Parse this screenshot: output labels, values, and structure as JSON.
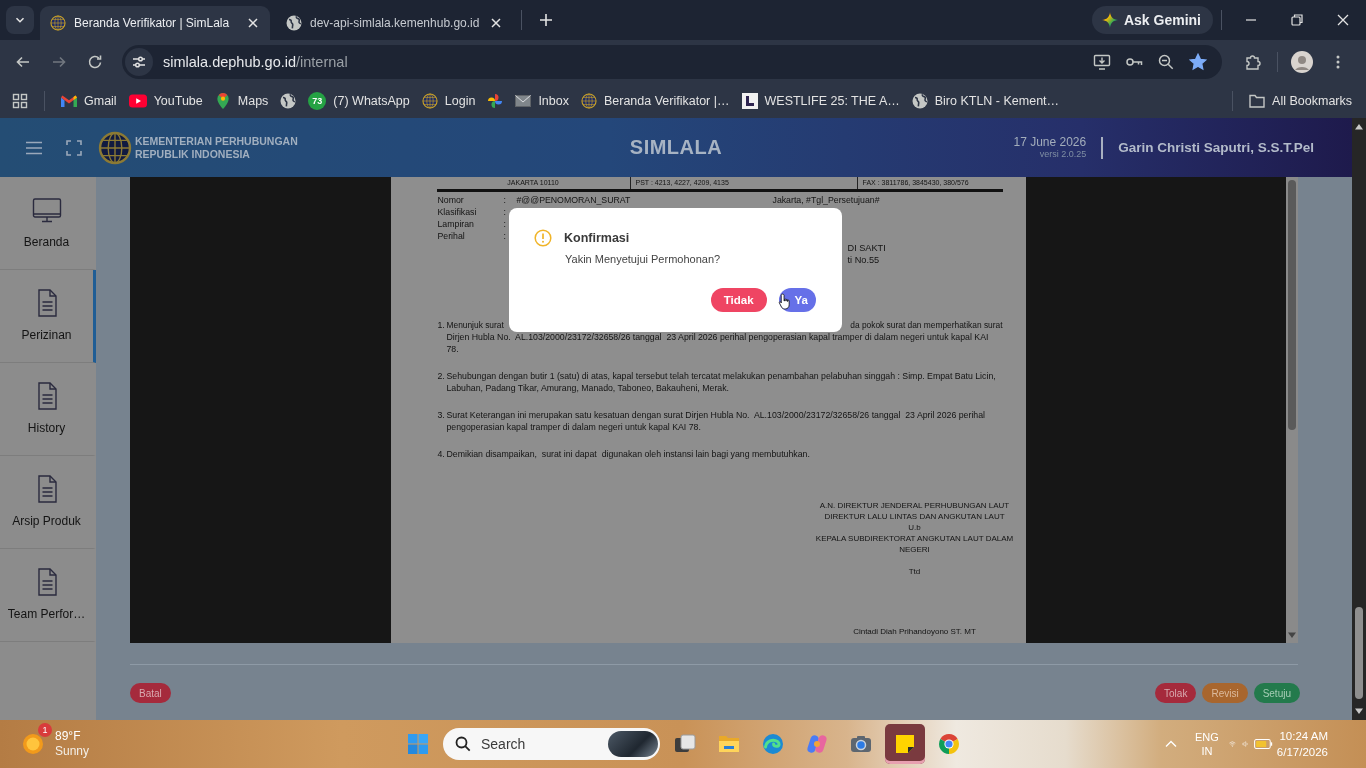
{
  "browser": {
    "tabs": [
      {
        "kind": "emblem",
        "title": "Beranda Verifikator | SimLala",
        "selected": true
      },
      {
        "kind": "globe",
        "title": "dev-api-simlala.kemenhub.go.id",
        "selected": false
      }
    ],
    "gemini_button": "Ask Gemini",
    "forward_disabled": true,
    "address": {
      "host": "simlala.dephub.go.id",
      "path": "/internal",
      "bookmarked": true
    },
    "bookmarks": [
      {
        "kind": "gmail",
        "label": "Gmail"
      },
      {
        "kind": "youtube",
        "label": "YouTube"
      },
      {
        "kind": "maps",
        "label": "Maps"
      },
      {
        "kind": "globe"
      },
      {
        "kind": "whatsapp",
        "badge": "73",
        "label": "(7) WhatsApp"
      },
      {
        "kind": "emblem",
        "label": "Login"
      },
      {
        "kind": "pinwheel"
      },
      {
        "kind": "mail",
        "label": "Inbox"
      },
      {
        "kind": "emblem",
        "label": "Beranda Verifikator |…"
      },
      {
        "kind": "letter-tile",
        "label": "WESTLIFE 25: THE A…"
      },
      {
        "kind": "globe",
        "label": "Biro KTLN - Kement…"
      }
    ],
    "all_bookmarks": "All Bookmarks"
  },
  "app": {
    "header": {
      "org_line_1": "KEMENTERIAN PERHUBUNGAN",
      "org_line_2": "REPUBLIK INDONESIA",
      "title": "SIMLALA",
      "date": "17 June 2026",
      "version": "versi 2.0.25",
      "user": "Garin Christi Saputri, S.S.T.Pel"
    },
    "sidebar": {
      "items": [
        {
          "kind": "monitor",
          "label": "Beranda",
          "selected": false
        },
        {
          "kind": "document",
          "label": "Perizinan",
          "selected": true
        },
        {
          "kind": "document",
          "label": "History",
          "selected": false
        },
        {
          "kind": "document",
          "label": "Arsip Produk",
          "selected": false
        },
        {
          "kind": "document",
          "label": "Team Perfor…",
          "selected": false
        }
      ]
    },
    "document": {
      "letterhead": [
        "JAKARTA 10110",
        "PST : 4213, 4227, 4209, 4135",
        "FAX : 3811786, 3845430, 380/576"
      ],
      "fields": [
        {
          "label": "Nomor",
          "colon": ":",
          "value": "#@@PENOMORAN_SURAT",
          "aside": "Jakarta, #Tgl_Persetujuan#"
        },
        {
          "label": "Klasifikasi",
          "colon": ":"
        },
        {
          "label": "Lampiran",
          "colon": ":"
        },
        {
          "label": "Perihal",
          "colon": ":"
        }
      ],
      "address_fragments": [
        "DI SAKTI",
        "ti No.55"
      ],
      "points": [
        {
          "number": "1.",
          "first_line_start": "Menunjuk surat",
          "first_line_end": "da pokok surat dan memperhatikan surat",
          "text": "Dirjen Hubla No.  AL.103/2000/23172/32658/26 tanggal  23 April 2026 perihal pengoperasian kapal tramper di dalam negeri untuk kapal KAI 78."
        },
        {
          "number": "2.",
          "text": "Sehubungan dengan butir 1 (satu) di atas, kapal tersebut telah tercatat melakukan penambahan pelabuhan singgah : Simp. Empat Batu Licin, Labuhan, Padang Tikar, Amurang, Manado, Taboneo, Bakauheni, Merak."
        },
        {
          "number": "3.",
          "text": "Surat Keterangan ini merupakan satu kesatuan dengan surat Dirjen Hubla No.  AL.103/2000/23172/32658/26 tanggal  23 April 2026 perihal pengoperasian kapal tramper di dalam negeri untuk kapal KAI 78."
        },
        {
          "number": "4.",
          "text": "Demikian disampaikan,  surat ini dapat  digunakan oleh instansi lain bagi yang membutuhkan."
        }
      ],
      "signature": [
        "A.N. DIREKTUR JENDERAL PERHUBUNGAN LAUT",
        "DIREKTUR LALU LINTAS DAN ANGKUTAN LAUT",
        "U.b",
        "KEPALA SUBDIREKTORAT ANGKUTAN LAUT DALAM NEGERI"
      ],
      "sign_mark": "Ttd",
      "signatory": "Cintadi Diah Prihandoyono ST. MT"
    },
    "actions": {
      "left": [
        {
          "kind": "danger",
          "label": "Batal"
        }
      ],
      "right": [
        {
          "kind": "danger",
          "label": "Tolak"
        },
        {
          "kind": "warning",
          "label": "Revisi"
        },
        {
          "kind": "success",
          "label": "Setuju"
        }
      ]
    },
    "dialog": {
      "title": "Konfirmasi",
      "message": "Yakin Menyetujui Permohonan?",
      "buttons": [
        {
          "kind": "cancel",
          "label": "Tidak"
        },
        {
          "kind": "confirm",
          "label": "Ya"
        }
      ]
    }
  },
  "taskbar": {
    "weather": {
      "badge": "1",
      "temperature": "89°F",
      "condition": "Sunny"
    },
    "search": {
      "placeholder": "Search"
    },
    "apps": [
      {
        "kind": "task-view",
        "selected": false
      },
      {
        "kind": "file-explorer",
        "selected": false
      },
      {
        "kind": "edge",
        "selected": false
      },
      {
        "kind": "copilot",
        "selected": false
      },
      {
        "kind": "camera",
        "selected": false
      },
      {
        "kind": "sticky-notes",
        "selected": true
      },
      {
        "kind": "chrome",
        "selected": false
      }
    ],
    "language": {
      "code": "ENG",
      "region": "IN"
    },
    "time": "10:24 AM",
    "date": "6/17/2026"
  }
}
